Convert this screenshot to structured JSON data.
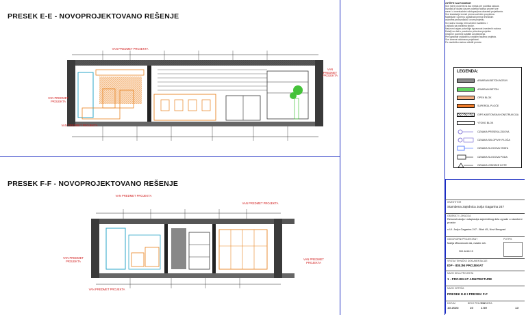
{
  "sections": {
    "top_title": "PRESEK E-E - NOVOPROJEKTOVANO REŠENJE",
    "bottom_title": "PRESEK F-F - NOVOPROJEKTOVANO REŠENJE"
  },
  "labels": {
    "red_prj_1": "VAN PREDMET PROJEKTA",
    "red_prj_2": "VAN PREDMET PROJEKTA",
    "red_prj_3": "VAN PREDMET PROJEKTA",
    "red_prj_4": "VAN PREDMET PROJEKTA",
    "red_prj_5": "VAN PREDMET PROJEKTA",
    "red_prj_6": "VAN PREDMET PROJEKTA",
    "red_prj_7": "VAN PREDMET PROJEKTA",
    "red_prj_8": "VAN PREDMET PROJEKTA",
    "red_prj_9": "VAN PREDMET PROJEKTA"
  },
  "notes": {
    "title": "OPŠTE NAPOMENE",
    "lines": [
      "Sve mere proveriti na licu mesta pre početka radova.",
      "Izvođač je dužan da pre početka radova proveri sve",
      "mere i o eventualnim odstupanjima obavesti projektanta.",
      "Sve instalacije izvesti prema važećim propisima.",
      "Materijale i opremu ugrađivati prema tehničkim",
      "uslovima proizvođača i ovom projektu.",
      "Svi radovi moraju biti izvedeni kvalitetno i",
      "u skladu sa pravilima struke.",
      "Nadzorni organ potvrđuje ispravnost izvedenih radova.",
      "Detalji su dati u posebnim prilozima projekta.",
      "Obojene površine zaštititi od oštećenja.",
      "Pre ugradnje uskladiti sa ostalim fazama projekta.",
      "Sve izmene odobrava projektant.",
      "Po završetku radova očistiti prostor."
    ]
  },
  "legend": {
    "title": "LEGENDA:",
    "items": [
      {
        "label": "ARMIRANI BETON NOSIVI",
        "color": "#8a8a8a",
        "pattern": "gray"
      },
      {
        "label": "ARMIRANI BETON",
        "color": "#5fd45f",
        "pattern": "green"
      },
      {
        "label": "OPEK BLOK",
        "color": "#f4b183",
        "pattern": "salmon"
      },
      {
        "label": "SUPERGIL PLOČE",
        "color": "#f07c2a",
        "pattern": "orange"
      },
      {
        "label": "GIPS KARTONSKA KONSTRUKCIJA",
        "color": "#ffffff",
        "pattern": "hatch"
      },
      {
        "label": "YTONG BLOK",
        "color": "#ffffff",
        "pattern": "blank"
      },
      {
        "label": "OZNAKA PRESEKA ZIDOVA",
        "color": "#6a5acd",
        "pattern": "sym1"
      },
      {
        "label": "OZNAKA SKLOPIVIH PLOČA",
        "color": "#6a5acd",
        "pattern": "sym2"
      },
      {
        "label": "OZNAKA SLOGOVA VRATA",
        "color": "#3a66ff",
        "pattern": "sym3"
      },
      {
        "label": "OZNAKA SLOGOVA PODA",
        "color": "#111111",
        "pattern": "sym4"
      },
      {
        "label": "OZNAKA VISINSKE KOTE",
        "color": "#111111",
        "pattern": "sym5"
      }
    ]
  },
  "title_block": {
    "investor_label": "INVESTITOR",
    "investor": "Stambena zajednica Jurija Gagarina 247",
    "object_label": "OBJEKAT / LOKACIJA",
    "object": "Rekonstrukcija i adaptacija zajedničkog dela zgrade u stambeni prostor",
    "location": "u Ul. Jurija Gagarina 247 - Blok 45, Novi Beograd",
    "designer_label": "ODGOVORNI PROJEKTANT",
    "designer": "Marija Milovanović dia, master arh.",
    "license": "300 A048 15",
    "signature_label": "POTPIS",
    "doc_type_label": "VRSTA TEHNIČKE DOKUMENTACIJE",
    "doc_type": "IDP - IDEJNI PROJEKAT",
    "part_label": "NAZIV DELA PROJEKTA",
    "part": "1 - PROJEKAT ARHITEKTURE",
    "drawing_label": "NAZIV CRTEŽA",
    "drawing": "PRESEK E-E I PRESEK F-F",
    "date_label": "DATUM",
    "date": "10.2023",
    "scale_label": "RAZMERA",
    "scale": "1:50",
    "number_label": "BROJ PRILOGA",
    "number": "10",
    "revision": "13"
  }
}
